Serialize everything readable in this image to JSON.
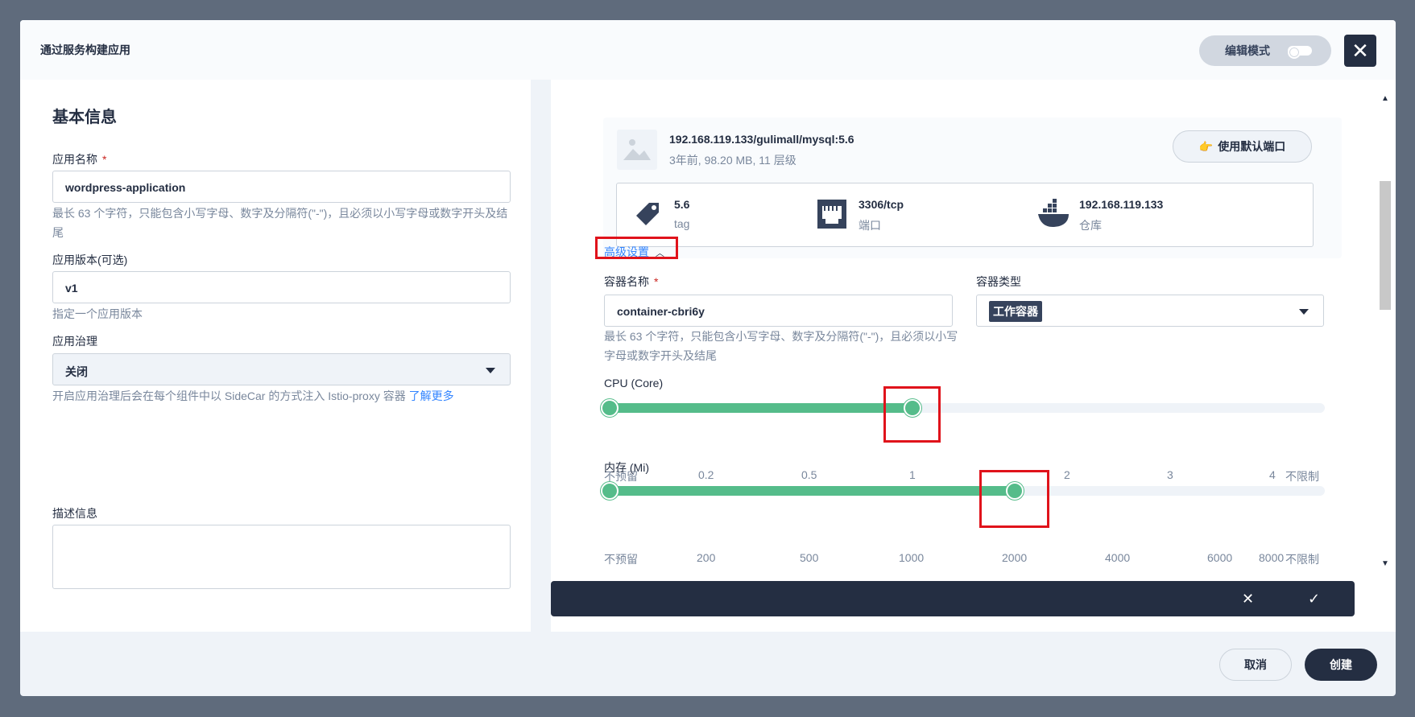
{
  "modal": {
    "title": "通过服务构建应用",
    "edit_mode_label": "编辑模式",
    "close_icon": "close-icon"
  },
  "basic_info": {
    "section_title": "基本信息",
    "app_name": {
      "label": "应用名称",
      "required_mark": "*",
      "value": "wordpress-application",
      "hint": "最长 63 个字符，只能包含小写字母、数字及分隔符(\"-\")，且必须以小写字母或数字开头及结尾"
    },
    "app_version": {
      "label": "应用版本(可选)",
      "value": "v1",
      "hint": "指定一个应用版本"
    },
    "governance": {
      "label": "应用治理",
      "selected": "关闭",
      "hint": "开启应用治理后会在每个组件中以 SideCar 的方式注入 Istio-proxy 容器",
      "learn_more": "了解更多"
    },
    "description": {
      "label": "描述信息",
      "value": ""
    }
  },
  "container": {
    "image": {
      "name": "192.168.119.133/gulimall/mysql:5.6",
      "meta": "3年前, 98.20 MB, 11 层级",
      "use_default_port_button": "使用默认端口",
      "tag_value": "5.6",
      "tag_label": "tag",
      "port_value": "3306/tcp",
      "port_label": "端口",
      "repo_value": "192.168.119.133",
      "repo_label": "仓库"
    },
    "advanced_settings_label": "高级设置",
    "container_name": {
      "label": "容器名称",
      "required_mark": "*",
      "value": "container-cbri6y",
      "hint": "最长 63 个字符，只能包含小写字母、数字及分隔符(\"-\")，且必须以小写字母或数字开头及结尾"
    },
    "container_type": {
      "label": "容器类型",
      "selected": "工作容器"
    },
    "cpu": {
      "label": "CPU (Core)",
      "ticks": [
        "不预留",
        "0.2",
        "0.5",
        "1",
        "2",
        "3",
        "4",
        "不限制"
      ],
      "selected_tick_index": 3
    },
    "memory": {
      "label": "内存 (Mi)",
      "ticks": [
        "不预留",
        "200",
        "500",
        "1000",
        "2000",
        "4000",
        "6000",
        "8000",
        "不限制"
      ],
      "selected_tick_index": 4
    }
  },
  "footer": {
    "cancel": "取消",
    "create": "创建"
  },
  "colors": {
    "accent_green": "#55bc8a",
    "dark": "#242e42",
    "highlight_red": "#e0131b",
    "link_blue": "#3385ff"
  }
}
